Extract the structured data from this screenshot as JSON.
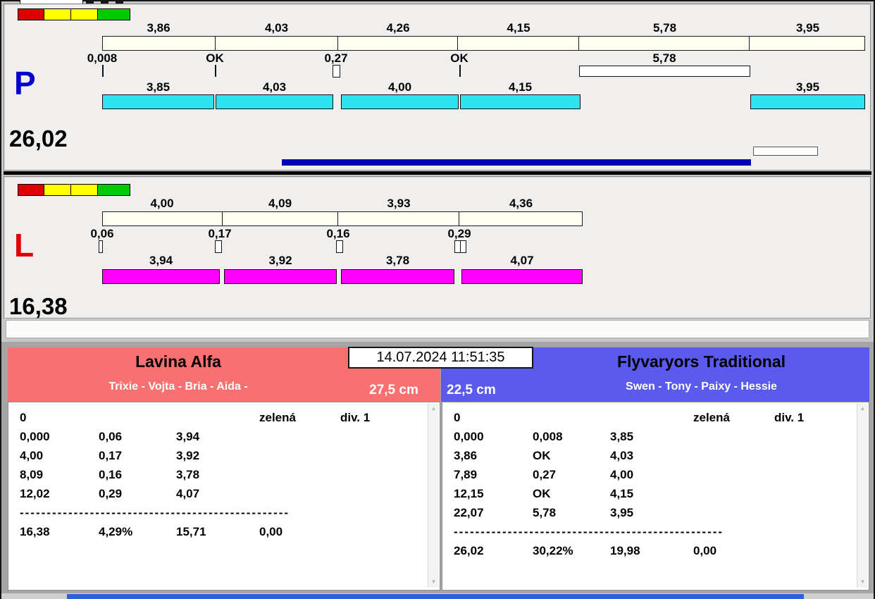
{
  "race": {
    "datetime": "14.07.2024 11:51:35"
  },
  "panel_p": {
    "letter": "P",
    "total": "26,02",
    "splits_top": [
      "3,86",
      "4,03",
      "4,26",
      "4,15",
      "5,78",
      "3,95"
    ],
    "exchanges": [
      "0,008",
      "OK",
      "0,27",
      "OK",
      "5,78"
    ],
    "splits_bottom": [
      "3,85",
      "4,03",
      "4,00",
      "4,15",
      "3,95"
    ],
    "status_lights": [
      "#dd0000",
      "#ffff00",
      "#ffff00",
      "#00cc00"
    ]
  },
  "panel_l": {
    "letter": "L",
    "total": "16,38",
    "splits_top": [
      "4,00",
      "4,09",
      "3,93",
      "4,36"
    ],
    "exchanges": [
      "0,06",
      "0,17",
      "0,16",
      "0,29"
    ],
    "splits_bottom": [
      "3,94",
      "3,92",
      "3,78",
      "4,07"
    ],
    "status_lights": [
      "#dd0000",
      "#ffff00",
      "#ffff00",
      "#00cc00"
    ]
  },
  "team_left": {
    "name": "Lavina Alfa",
    "members": "Trixie - Vojta - Bria - Aida -",
    "jump_height": "27,5 cm",
    "rows": [
      [
        "0",
        "",
        "",
        "zelená",
        "div. 1"
      ],
      [
        "0,000",
        "0,06",
        "3,94",
        "",
        ""
      ],
      [
        "4,00",
        "0,17",
        "3,92",
        "",
        ""
      ],
      [
        "8,09",
        "0,16",
        "3,78",
        "",
        ""
      ],
      [
        "12,02",
        "0,29",
        "4,07",
        "",
        ""
      ]
    ],
    "separator": "--------------------------------------------------",
    "total_row": [
      "16,38",
      "4,29%",
      "15,71",
      "0,00"
    ]
  },
  "team_right": {
    "name": "Flyvaryors Traditional",
    "members": "Swen - Tony - Paixy - Hessie",
    "jump_height": "22,5 cm",
    "rows": [
      [
        "0",
        "",
        "",
        "zelená",
        "div. 1"
      ],
      [
        "0,000",
        "0,008",
        "3,85",
        "",
        ""
      ],
      [
        "3,86",
        "OK",
        "4,03",
        "",
        ""
      ],
      [
        "7,89",
        "0,27",
        "4,00",
        "",
        ""
      ],
      [
        "12,15",
        "OK",
        "4,15",
        "",
        ""
      ],
      [
        "22,07",
        "5,78",
        "3,95",
        "",
        ""
      ]
    ],
    "separator": "--------------------------------------------------",
    "total_row": [
      "26,02",
      "30,22%",
      "19,98",
      "0,00"
    ]
  },
  "icons": {
    "scroll_up": "▲",
    "scroll_down": "▼"
  },
  "colors": {
    "p_lane_bar": "#2ee3ef",
    "l_lane_bar": "#ff00ff",
    "split_bar": "#fffff0",
    "progress_bar": "#0000b4",
    "team_left_header": "#f97070",
    "team_right_header": "#5a5aee",
    "p_letter": "#0000cd",
    "l_letter": "#e10000"
  }
}
